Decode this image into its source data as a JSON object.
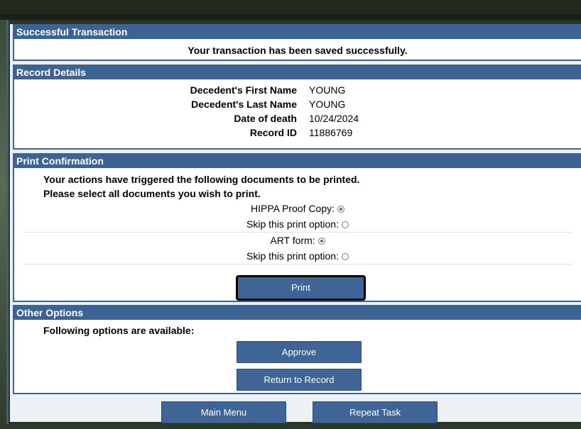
{
  "success": {
    "header": "Successful Transaction",
    "message": "Your transaction has been saved successfully."
  },
  "record": {
    "header": "Record Details",
    "fields": [
      {
        "label": "Decedent's First Name",
        "value": "YOUNG"
      },
      {
        "label": "Decedent's Last Name",
        "value": "YOUNG"
      },
      {
        "label": "Date of death",
        "value": "10/24/2024"
      },
      {
        "label": "Record ID",
        "value": "11886769"
      }
    ]
  },
  "print": {
    "header": "Print Confirmation",
    "line1": "Your actions have triggered the following documents to be printed.",
    "line2": "Please select all documents you wish to print.",
    "options": [
      {
        "label": "HIPPA Proof Copy:",
        "selected": true
      },
      {
        "label": "Skip this print option:",
        "selected": false
      },
      {
        "label": "ART form:",
        "selected": true
      },
      {
        "label": "Skip this print option:",
        "selected": false
      }
    ],
    "button": "Print"
  },
  "other": {
    "header": "Other Options",
    "text": "Following options are available:",
    "approve": "Approve",
    "return": "Return to Record"
  },
  "footer": {
    "main_menu": "Main Menu",
    "repeat_task": "Repeat Task"
  },
  "colors": {
    "header_blue": "#3d6394",
    "button_blue": "#3f6596"
  }
}
